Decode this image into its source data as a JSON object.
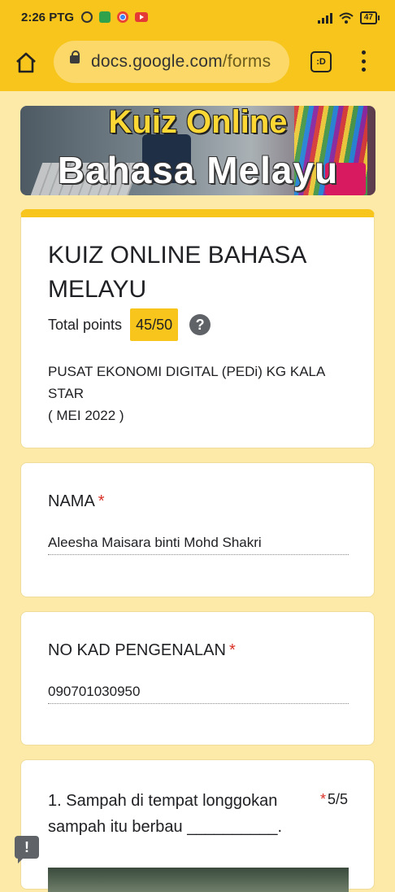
{
  "status_bar": {
    "time": "2:26 PTG",
    "battery": "47"
  },
  "browser": {
    "url_domain": "docs.google.com",
    "url_path": "/forms",
    "tabs_label": ":D"
  },
  "banner": {
    "line1": "Kuiz Online",
    "line2": "Bahasa Melayu"
  },
  "form": {
    "title": "KUIZ ONLINE BAHASA MELAYU",
    "points_label": "Total points",
    "points_value": "45/50",
    "description_line1": "PUSAT EKONOMI DIGITAL (PEDi) KG KALA STAR",
    "description_line2": "( MEI 2022 )"
  },
  "questions": [
    {
      "label": "NAMA",
      "required": "*",
      "answer": "Aleesha Maisara binti Mohd Shakri"
    },
    {
      "label": "NO KAD PENGENALAN",
      "required": "*",
      "answer": "090701030950"
    },
    {
      "label": "1. Sampah di tempat longgokan sampah itu berbau __________.",
      "required": "*",
      "score": "5/5"
    }
  ],
  "colors": {
    "accent": "#f7c51b",
    "background": "#fde9a8",
    "required": "#d93025"
  },
  "icons": [
    "home-icon",
    "lock-icon",
    "tabs-icon",
    "overflow-menu-icon",
    "help-icon",
    "feedback-icon"
  ]
}
